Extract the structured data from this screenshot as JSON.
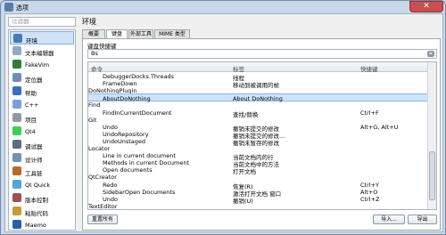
{
  "window": {
    "title": "选项",
    "close_label": "✕"
  },
  "sidebar": {
    "filter_placeholder": "过滤器",
    "items": [
      {
        "label": "环境",
        "icon": "desktop-icon",
        "color": "#4a78b8",
        "selected": true
      },
      {
        "label": "文本编辑器",
        "icon": "text-editor-icon",
        "color": "#8fa9c8"
      },
      {
        "label": "FakeVim",
        "icon": "fakevim-icon",
        "color": "#2f7d32"
      },
      {
        "label": "定位器",
        "icon": "locator-icon",
        "color": "#6f8fb3"
      },
      {
        "label": "帮助",
        "icon": "help-icon",
        "color": "#3b6fbf"
      },
      {
        "label": "C++",
        "icon": "cpp-icon",
        "color": "#7aa2d8"
      },
      {
        "label": "项目",
        "icon": "project-icon",
        "color": "#909aa6"
      },
      {
        "label": "Qt4",
        "icon": "qt4-icon",
        "color": "#41cd52"
      },
      {
        "label": "调试器",
        "icon": "debugger-icon",
        "color": "#5d6e86"
      },
      {
        "label": "设计师",
        "icon": "designer-icon",
        "color": "#7590b5"
      },
      {
        "label": "工具链",
        "icon": "toolchain-icon",
        "color": "#b56b2a"
      },
      {
        "label": "Qt Quick",
        "icon": "qtquick-icon",
        "color": "#52a6d8"
      },
      {
        "label": "版本控制",
        "icon": "version-control-icon",
        "color": "#a05050"
      },
      {
        "label": "粘贴代码",
        "icon": "paste-code-icon",
        "color": "#c79a36"
      },
      {
        "label": "Maemo",
        "icon": "maemo-icon",
        "color": "#2a5fa8"
      }
    ]
  },
  "page": {
    "title": "环境"
  },
  "tabs": [
    {
      "label": "概要",
      "active": false
    },
    {
      "label": "键盘",
      "active": true
    },
    {
      "label": "外部工具",
      "active": false
    },
    {
      "label": "MIME 类型",
      "active": false
    }
  ],
  "shortcuts": {
    "group_label": "键盘快捷键",
    "search_value": "Bs",
    "clear_label": "✕",
    "headers": {
      "command": "命令",
      "label": "标签",
      "shortcut": "快捷键"
    },
    "rows": [
      {
        "type": "item",
        "command": "DebuggerDocks.Threads",
        "label": "线程",
        "shortcut": ""
      },
      {
        "type": "item",
        "command": "FrameDown",
        "label": "移动到被调用的帧",
        "shortcut": ""
      },
      {
        "type": "group",
        "command": "DoNothingPlugin",
        "label": "",
        "shortcut": ""
      },
      {
        "type": "item",
        "command": "AboutDoNothing",
        "label": "About DoNothing",
        "shortcut": "",
        "selected": true
      },
      {
        "type": "group",
        "command": "Find",
        "label": "",
        "shortcut": ""
      },
      {
        "type": "item",
        "command": "FindInCurrentDocument",
        "label": "查找/替换",
        "shortcut": "Ctrl+F"
      },
      {
        "type": "group",
        "command": "Git",
        "label": "",
        "shortcut": ""
      },
      {
        "type": "item",
        "command": "Undo",
        "label": "撤销未提交的修改",
        "shortcut": "Alt+G, Alt+U"
      },
      {
        "type": "item",
        "command": "UndoRepository",
        "label": "撤销未提交的修改...",
        "shortcut": ""
      },
      {
        "type": "item",
        "command": "UndoUnstaged",
        "label": "撤销未暂存的修改",
        "shortcut": ""
      },
      {
        "type": "group",
        "command": "Locator",
        "label": "",
        "shortcut": ""
      },
      {
        "type": "item",
        "command": "Line in current document",
        "label": "当前文档内的行",
        "shortcut": ""
      },
      {
        "type": "item",
        "command": "Methods in current Document",
        "label": "当前文档中的方法",
        "shortcut": ""
      },
      {
        "type": "item",
        "command": "Open documents",
        "label": "打开文档",
        "shortcut": ""
      },
      {
        "type": "group",
        "command": "QtCreator",
        "label": "",
        "shortcut": ""
      },
      {
        "type": "item",
        "command": "Redo",
        "label": "恢复(R)",
        "shortcut": "Ctrl+Y"
      },
      {
        "type": "item",
        "command": "SidebarOpen Documents",
        "label": "激活打开文档 窗口",
        "shortcut": "Alt+O"
      },
      {
        "type": "item",
        "command": "Undo",
        "label": "撤销(U)",
        "shortcut": "Ctrl+Z"
      },
      {
        "type": "group",
        "command": "TextEditor",
        "label": "",
        "shortcut": ""
      }
    ]
  },
  "buttons": {
    "reset_all": "重置所有",
    "import": "导入...",
    "export": "导出"
  }
}
